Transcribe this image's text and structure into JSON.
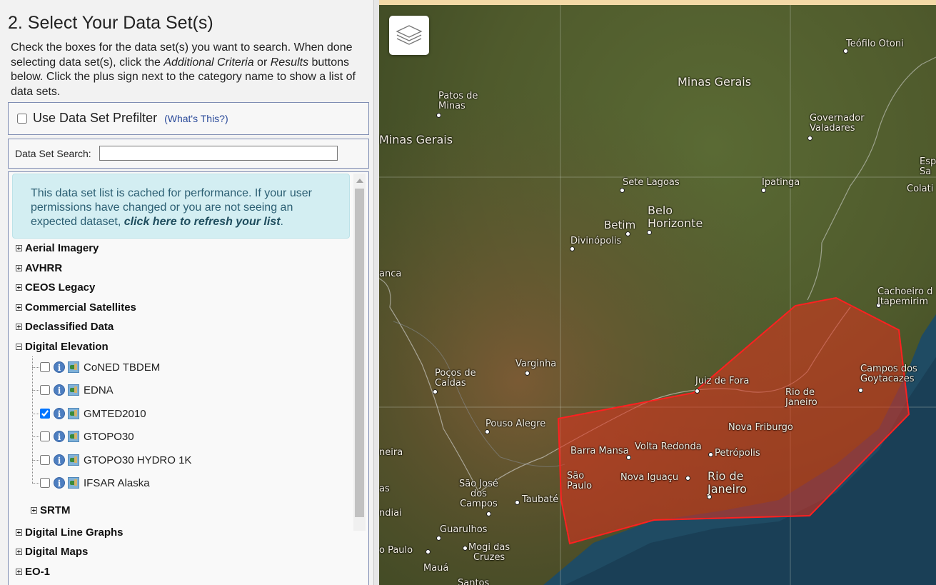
{
  "left_panel": {
    "title": "2. Select Your Data Set(s)",
    "instructions": {
      "part1": "Check the boxes for the data set(s) you want to search. When done selecting data set(s), click the ",
      "additional": "Additional Criteria",
      "or": " or ",
      "results": "Results",
      "part2": " buttons below. Click the plus sign next to the category name to show a list of data sets."
    },
    "prefilter": {
      "label": "Use Data Set Prefilter",
      "help_link": "(What's This?)"
    },
    "search": {
      "label": "Data Set Search:",
      "value": ""
    },
    "cache_notice": {
      "text": "This data set list is cached for performance. If your user permissions have changed or you are not seeing an expected dataset, ",
      "link": "click here to refresh your list",
      "end": "."
    },
    "categories_top": [
      "Aerial Imagery",
      "AVHRR",
      "CEOS Legacy",
      "Commercial Satellites",
      "Declassified Data",
      "Digital Elevation"
    ],
    "digital_elevation_datasets": [
      {
        "name": "CoNED TBDEM",
        "checked": false
      },
      {
        "name": "EDNA",
        "checked": false
      },
      {
        "name": "GMTED2010",
        "checked": true
      },
      {
        "name": "GTOPO30",
        "checked": false
      },
      {
        "name": "GTOPO30 HYDRO 1K",
        "checked": false
      },
      {
        "name": "IFSAR Alaska",
        "checked": false
      }
    ],
    "subcategory": "SRTM",
    "categories_bottom": [
      "Digital Line Graphs",
      "Digital Maps",
      "EO-1"
    ],
    "info_icon_glyph": "i"
  },
  "map": {
    "labels": {
      "teofilo_otoni": "Teófilo Otoni",
      "minas_gerais_big": "Minas Gerais",
      "patos_de_minas": "Patos de\nMinas",
      "governador_valadares": "Governador\nValadares",
      "minas_gerais_left": "Minas Gerais",
      "esp": "Esp\nSa",
      "colatina": "Colati",
      "sete_lagoas": "Sete Lagoas",
      "ipatinga": "Ipatinga",
      "belo_horizonte": "Belo\nHorizonte",
      "betim": "Betim",
      "divinopolis": "Divinópolis",
      "anca": "anca",
      "cachoeiro": "Cachoeiro d\nItapemirim",
      "varginha": "Varginha",
      "pocos_de_caldas": "Poços de\nCaldas",
      "juiz_de_fora": "Juiz de Fora",
      "campos": "Campos dos\nGoytacazes",
      "rio_state": "Rio de\nJaneiro",
      "pouso_alegre": "Pouso Alegre",
      "nova_friburgo": "Nova Friburgo",
      "neira": "neira",
      "barra_mansa": "Barra Mansa",
      "volta_redonda": "Volta Redonda",
      "petropolis": "Petrópolis",
      "sao_paulo_state": "São\nPaulo",
      "nova_iguacu": "Nova Iguaçu",
      "rio_city": "Rio de\nJaneiro",
      "sao_jose": "São José\ndos\nCampos",
      "taubate": "Taubaté",
      "as": "as",
      "ndiai": "ndiai",
      "guarulhos": "Guarulhos",
      "sao_paulo_city": "o Paulo",
      "mogi": "Mogi das\nCruzes",
      "maua": "Mauá",
      "santos": "Santos"
    },
    "layer_button_icon": "layers-icon",
    "aoi_fill": "#e0321e",
    "aoi_stroke": "#ff2020"
  }
}
